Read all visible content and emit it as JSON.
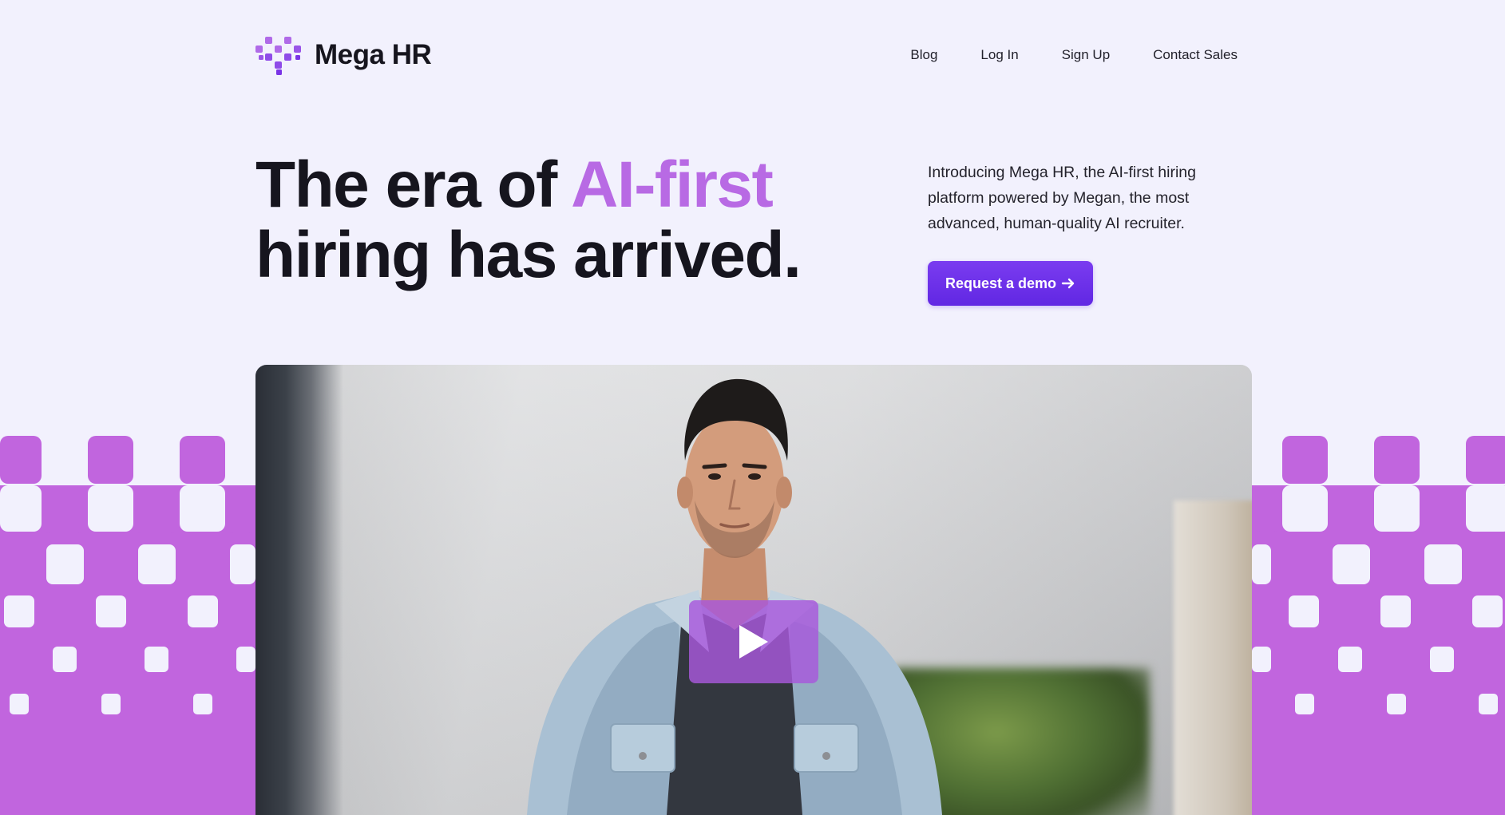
{
  "header": {
    "brand_name": "Mega HR",
    "logo_icon": "mega-hr-pixel-heart-logo",
    "nav": [
      {
        "label": "Blog"
      },
      {
        "label": "Log In"
      },
      {
        "label": "Sign Up"
      },
      {
        "label": "Contact Sales"
      }
    ]
  },
  "hero": {
    "title_part1": "The era of ",
    "title_accent": "AI-first",
    "title_part2": "hiring has arrived.",
    "description": "Introducing Mega HR, the AI-first hiring platform powered by Megan, the most advanced, human-quality AI recruiter.",
    "cta_label": "Request a demo",
    "cta_icon": "arrow-right-icon"
  },
  "video": {
    "play_icon": "play-icon"
  },
  "colors": {
    "background": "#f2f1fd",
    "accent_text": "#b86ae4",
    "button": "#6a2fe8",
    "pattern": "#c165de",
    "logo_light": "#b06ae8",
    "logo_dark": "#7a34e6"
  }
}
